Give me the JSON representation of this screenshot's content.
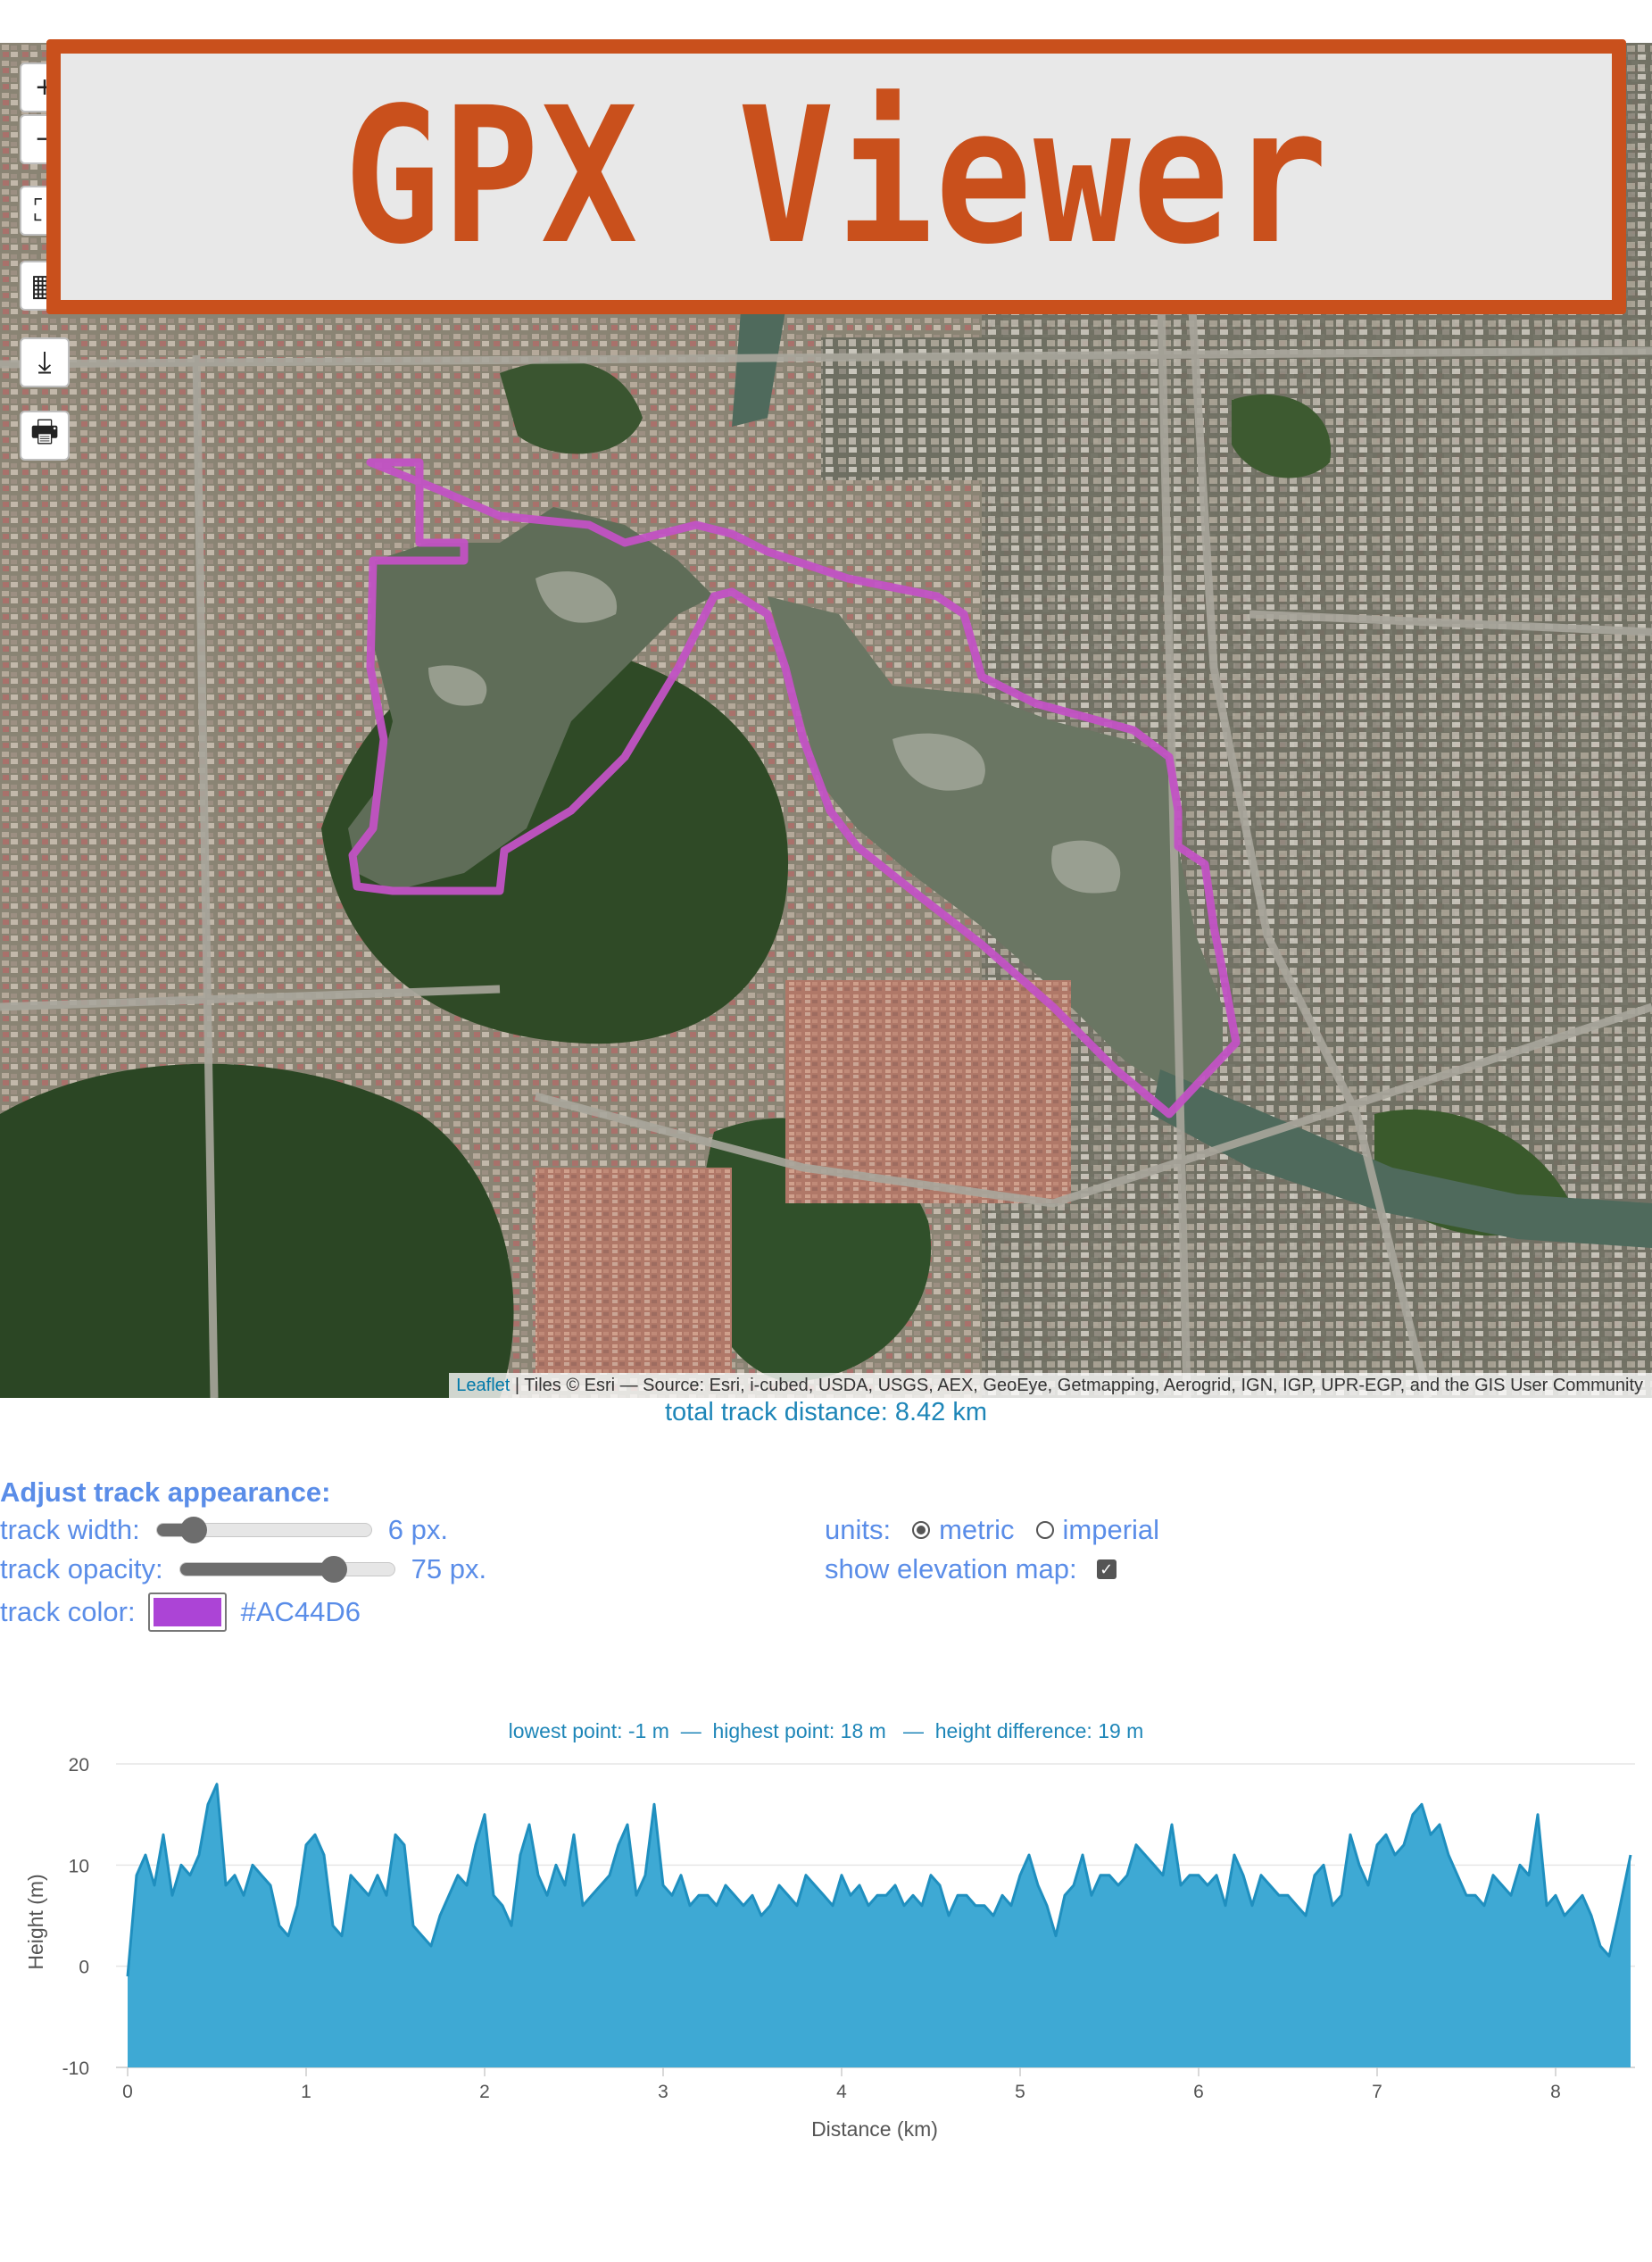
{
  "app": {
    "title": "GPX Viewer"
  },
  "map": {
    "controls": [
      {
        "name": "zoom-in",
        "symbol": "+"
      },
      {
        "name": "zoom-out",
        "symbol": "−"
      },
      {
        "name": "fullscreen",
        "symbol": "⛶"
      },
      {
        "name": "layers",
        "symbol": "▦"
      },
      {
        "name": "download",
        "symbol": "⤓"
      },
      {
        "name": "print",
        "symbol": "🖶"
      }
    ],
    "attribution": {
      "link_text": "Leaflet",
      "text": " | Tiles © Esri — Source: Esri, i-cubed, USDA, USGS, AEX, GeoEye, Getmapping, Aerogrid, IGN, IGP, UPR-EGP, and the GIS User Community"
    },
    "track_color": "#AC44D6"
  },
  "summary": {
    "distance_text": "total track distance: 8.42 km"
  },
  "appearance": {
    "title": "Adjust track appearance:",
    "width_label": "track width:",
    "width_value": "6 px.",
    "width_fraction": 0.17,
    "opacity_label": "track opacity:",
    "opacity_value": "75 px.",
    "opacity_fraction": 0.72,
    "color_label": "track color:",
    "color_value": "#AC44D6",
    "units_label": "units:",
    "units_options": [
      "metric",
      "imperial"
    ],
    "units_selected": "metric",
    "elevation_label": "show elevation map:",
    "elevation_checked": true
  },
  "elevation": {
    "stats_lowest": "lowest point: -1 m",
    "stats_highest": "highest point: 18 m",
    "stats_difference": "height difference: 19 m",
    "separator": "—"
  },
  "chart_data": {
    "type": "area",
    "xlabel": "Distance (km)",
    "ylabel": "Height (m)",
    "xlim": [
      0,
      8.42
    ],
    "ylim": [
      -10,
      20
    ],
    "xticks": [
      "0",
      "1",
      "2",
      "3",
      "4",
      "5",
      "6",
      "7",
      "8"
    ],
    "yticks": [
      "20",
      "10",
      "0",
      "-10"
    ],
    "grid": true,
    "color": "#3ea9d4",
    "x": [
      0.0,
      0.05,
      0.1,
      0.15,
      0.2,
      0.25,
      0.3,
      0.35,
      0.4,
      0.45,
      0.5,
      0.55,
      0.6,
      0.65,
      0.7,
      0.75,
      0.8,
      0.85,
      0.9,
      0.95,
      1.0,
      1.05,
      1.1,
      1.15,
      1.2,
      1.25,
      1.3,
      1.35,
      1.4,
      1.45,
      1.5,
      1.55,
      1.6,
      1.65,
      1.7,
      1.75,
      1.8,
      1.85,
      1.9,
      1.95,
      2.0,
      2.05,
      2.1,
      2.15,
      2.2,
      2.25,
      2.3,
      2.35,
      2.4,
      2.45,
      2.5,
      2.55,
      2.6,
      2.65,
      2.7,
      2.75,
      2.8,
      2.85,
      2.9,
      2.95,
      3.0,
      3.05,
      3.1,
      3.15,
      3.2,
      3.25,
      3.3,
      3.35,
      3.4,
      3.45,
      3.5,
      3.55,
      3.6,
      3.65,
      3.7,
      3.75,
      3.8,
      3.85,
      3.9,
      3.95,
      4.0,
      4.05,
      4.1,
      4.15,
      4.2,
      4.25,
      4.3,
      4.35,
      4.4,
      4.45,
      4.5,
      4.55,
      4.6,
      4.65,
      4.7,
      4.75,
      4.8,
      4.85,
      4.9,
      4.95,
      5.0,
      5.05,
      5.1,
      5.15,
      5.2,
      5.25,
      5.3,
      5.35,
      5.4,
      5.45,
      5.5,
      5.55,
      5.6,
      5.65,
      5.7,
      5.75,
      5.8,
      5.85,
      5.9,
      5.95,
      6.0,
      6.05,
      6.1,
      6.15,
      6.2,
      6.25,
      6.3,
      6.35,
      6.4,
      6.45,
      6.5,
      6.55,
      6.6,
      6.65,
      6.7,
      6.75,
      6.8,
      6.85,
      6.9,
      6.95,
      7.0,
      7.05,
      7.1,
      7.15,
      7.2,
      7.25,
      7.3,
      7.35,
      7.4,
      7.45,
      7.5,
      7.55,
      7.6,
      7.65,
      7.7,
      7.75,
      7.8,
      7.85,
      7.9,
      7.95,
      8.0,
      8.05,
      8.1,
      8.15,
      8.2,
      8.25,
      8.3,
      8.35,
      8.42
    ],
    "series": [
      {
        "values": [
          -1,
          9,
          11,
          8,
          13,
          7,
          10,
          9,
          11,
          16,
          18,
          8,
          9,
          7,
          10,
          9,
          8,
          4,
          3,
          6,
          12,
          13,
          11,
          4,
          3,
          9,
          8,
          7,
          9,
          7,
          13,
          12,
          4,
          3,
          2,
          5,
          7,
          9,
          8,
          12,
          15,
          7,
          6,
          4,
          11,
          14,
          9,
          7,
          10,
          8,
          13,
          6,
          7,
          8,
          9,
          12,
          14,
          7,
          9,
          16,
          8,
          7,
          9,
          6,
          7,
          7,
          6,
          8,
          7,
          6,
          7,
          5,
          6,
          8,
          7,
          6,
          9,
          8,
          7,
          6,
          9,
          7,
          8,
          6,
          7,
          7,
          8,
          6,
          7,
          6,
          9,
          8,
          5,
          7,
          7,
          6,
          6,
          5,
          7,
          6,
          9,
          11,
          8,
          6,
          3,
          7,
          8,
          11,
          7,
          9,
          9,
          8,
          9,
          12,
          11,
          10,
          9,
          14,
          8,
          9,
          9,
          8,
          9,
          6,
          11,
          9,
          6,
          9,
          8,
          7,
          7,
          6,
          5,
          9,
          10,
          6,
          7,
          13,
          10,
          8,
          12,
          13,
          11,
          12,
          15,
          16,
          13,
          14,
          11,
          9,
          7,
          7,
          6,
          9,
          8,
          7,
          10,
          9,
          15,
          6,
          7,
          5,
          6,
          7,
          5,
          2,
          1,
          5,
          11
        ]
      }
    ]
  }
}
